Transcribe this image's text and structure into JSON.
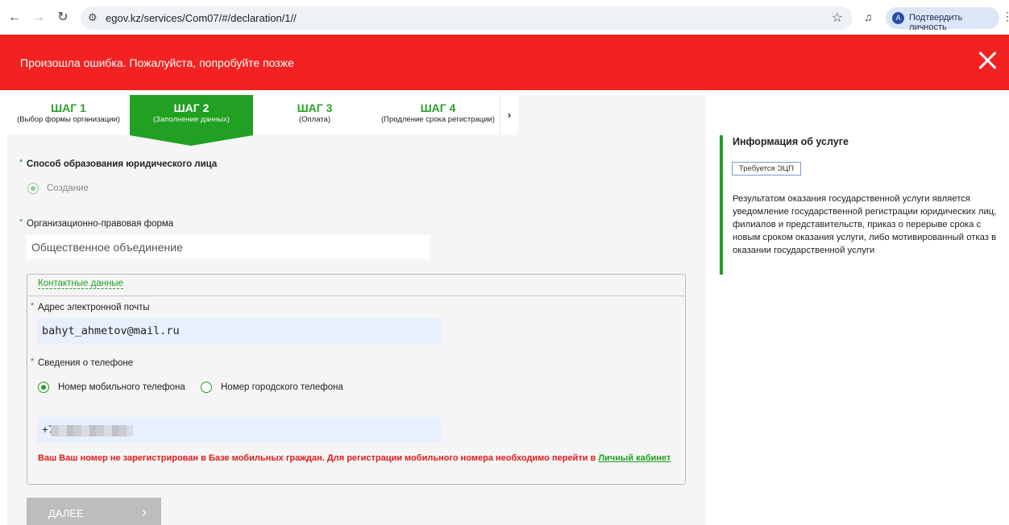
{
  "browser": {
    "url": "egov.kz/services/Com07/#/declaration/1//",
    "verify_label": "Подтвердить личность",
    "avatar_letter": "A"
  },
  "error_banner": {
    "message": "Произошла ошибка. Пожалуйста, попробуйте позже"
  },
  "steps": [
    {
      "title": "ШАГ 1",
      "subtitle": "(Выбор формы организации)",
      "active": false
    },
    {
      "title": "ШАГ 2",
      "subtitle": "(Заполнение данных)",
      "active": true
    },
    {
      "title": "ШАГ 3",
      "subtitle": "(Оплата)",
      "active": false
    },
    {
      "title": "ШАГ 4",
      "subtitle": "(Продление срока регистрации)",
      "active": false
    }
  ],
  "form": {
    "formation_method_label": "Способ образования юридического лица",
    "formation_option": "Создание",
    "legal_form_label": "Организационно-правовая форма",
    "legal_form_value": "Общественное объединение",
    "contacts_legend": "Контактные данные",
    "email_label": "Адрес электронной почты",
    "email_value": "bahyt_ahmetov@mail.ru",
    "phone_label": "Сведения о телефоне",
    "phone_mobile": "Номер мобильного телефона",
    "phone_landline": "Номер городского телефона",
    "phone_value": "+7",
    "warning_text": "Ваш Ваш номер не зарегистрирован в Базе мобильных граждан. Для регистрации мобильного номера необходимо перейти в",
    "warning_link": "Личный кабинет",
    "next_button": "ДАЛЕЕ"
  },
  "service_info": {
    "title": "Информация об услуге",
    "badge": "Требуется ЭЦП",
    "description": "Результатом оказания государственной услуги является уведомление государственной регистрации юридических лиц, филиалов и представительств, приказ о перерыве срока с новым сроком оказания услуги, либо мотивированный отказ в оказании государственной услуги"
  },
  "colors": {
    "accent": "#21a023",
    "error": "#f22222"
  }
}
